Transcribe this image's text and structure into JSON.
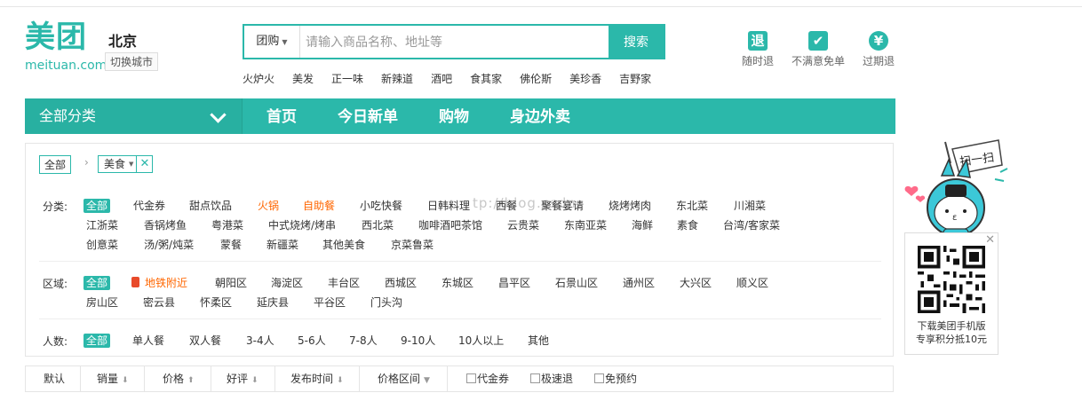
{
  "logo": {
    "cn": "美团",
    "en": "meituan.com"
  },
  "city": {
    "name": "北京",
    "switch_label": "切换城市"
  },
  "search": {
    "type_label": "团购",
    "placeholder": "请输入商品名称、地址等",
    "button_label": "搜索",
    "hot_words": [
      "火炉火",
      "美发",
      "正一味",
      "新辣道",
      "酒吧",
      "食其家",
      "佛伦斯",
      "美珍香",
      "吉野家"
    ]
  },
  "services": [
    {
      "icon": "refund-anytime-icon",
      "glyph": "退",
      "label": "随时退"
    },
    {
      "icon": "check-icon",
      "glyph": "✔",
      "label": "不满意免单"
    },
    {
      "icon": "expired-refund-icon",
      "glyph": "¥",
      "label": "过期退"
    }
  ],
  "nav": {
    "all_label": "全部分类",
    "links": [
      "首页",
      "今日新单",
      "购物",
      "身边外卖"
    ]
  },
  "breadcrumb": {
    "all": "全部",
    "sep": "›",
    "tag": "美食",
    "remove": "✕"
  },
  "filters": {
    "category": {
      "label": "分类:",
      "options": [
        "全部",
        "代金券",
        "甜点饮品",
        "火锅",
        "自助餐",
        "小吃快餐",
        "日韩料理",
        "西餐",
        "聚餐宴请",
        "烧烤烤肉",
        "东北菜",
        "川湘菜",
        "江浙菜",
        "香锅烤鱼",
        "粤港菜",
        "中式烧烤/烤串",
        "西北菜",
        "咖啡酒吧茶馆",
        "云贵菜",
        "东南亚菜",
        "海鲜",
        "素食",
        "台湾/客家菜",
        "创意菜",
        "汤/粥/炖菜",
        "蒙餐",
        "新疆菜",
        "其他美食",
        "京菜鲁菜"
      ]
    },
    "area": {
      "label": "区域:",
      "options": [
        "全部",
        "地铁附近",
        "朝阳区",
        "海淀区",
        "丰台区",
        "西城区",
        "东城区",
        "昌平区",
        "石景山区",
        "通州区",
        "大兴区",
        "顺义区",
        "房山区",
        "密云县",
        "怀柔区",
        "延庆县",
        "平谷区",
        "门头沟"
      ]
    },
    "people": {
      "label": "人数:",
      "options": [
        "全部",
        "单人餐",
        "双人餐",
        "3-4人",
        "5-6人",
        "7-8人",
        "9-10人",
        "10人以上",
        "其他"
      ]
    }
  },
  "sort": {
    "items": [
      "默认",
      "销量",
      "价格",
      "好评",
      "发布时间",
      "价格区间"
    ],
    "arrows": [
      "",
      "⬇",
      "⬆",
      "⬇",
      "⬇",
      "▼"
    ],
    "checkboxes": [
      "代金券",
      "极速退",
      "免预约"
    ]
  },
  "watermark": "tp://blog.csdn.",
  "mascot": {
    "speech": "扫一扫"
  },
  "qr": {
    "line1": "下载美团手机版",
    "line2": "专享积分抵10元",
    "close": "✕"
  },
  "colors": {
    "brand": "#2bb8aa",
    "highlight": "#ff6600",
    "subway": "#e84a2a"
  }
}
